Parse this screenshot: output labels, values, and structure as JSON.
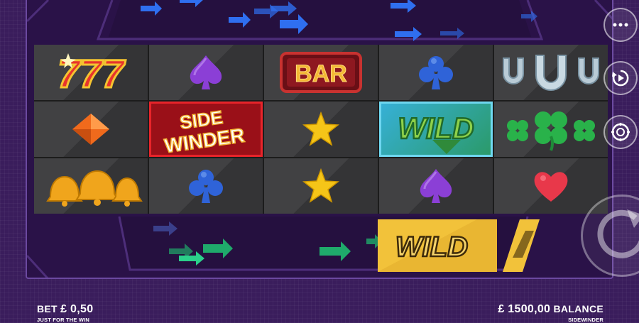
{
  "game": {
    "reels": [
      [
        "seven-777",
        "purple-spade",
        "bar",
        "blue-club",
        "horseshoe"
      ],
      [
        "orange-diamond",
        "sidewinder-logo",
        "gold-star",
        "wild",
        "four-leaf-clover"
      ],
      [
        "golden-bells",
        "blue-club",
        "gold-star",
        "purple-spade",
        "red-heart"
      ]
    ],
    "symbol_text": {
      "seven": "777",
      "bar": "BAR",
      "sidewinder_line1": "SIDE",
      "sidewinder_line2": "WINDER",
      "wild": "WILD"
    },
    "incoming_symbol": "wild",
    "incoming_symbol_text": "WILD"
  },
  "footer": {
    "bet_label": "BET",
    "bet_value": "£ 0,50",
    "bet_sub": "JUST FOR THE WIN",
    "balance_value": "£ 1500,00",
    "balance_label": "BALANCE",
    "balance_sub": "SIDEWINDER"
  },
  "controls": {
    "menu_icon": "ellipsis-icon",
    "autoplay_icon": "autoplay-icon",
    "bet_icon": "chip-icon",
    "spin_icon": "spin-arrow-icon"
  },
  "colors": {
    "background": "#3a1d5c",
    "frame_border": "#6b49a0",
    "cell": "#3b3b3d",
    "arrow_blue": "#2f6ff0",
    "arrow_green": "#1faa6b",
    "wild_gold": "#f2c23a"
  }
}
